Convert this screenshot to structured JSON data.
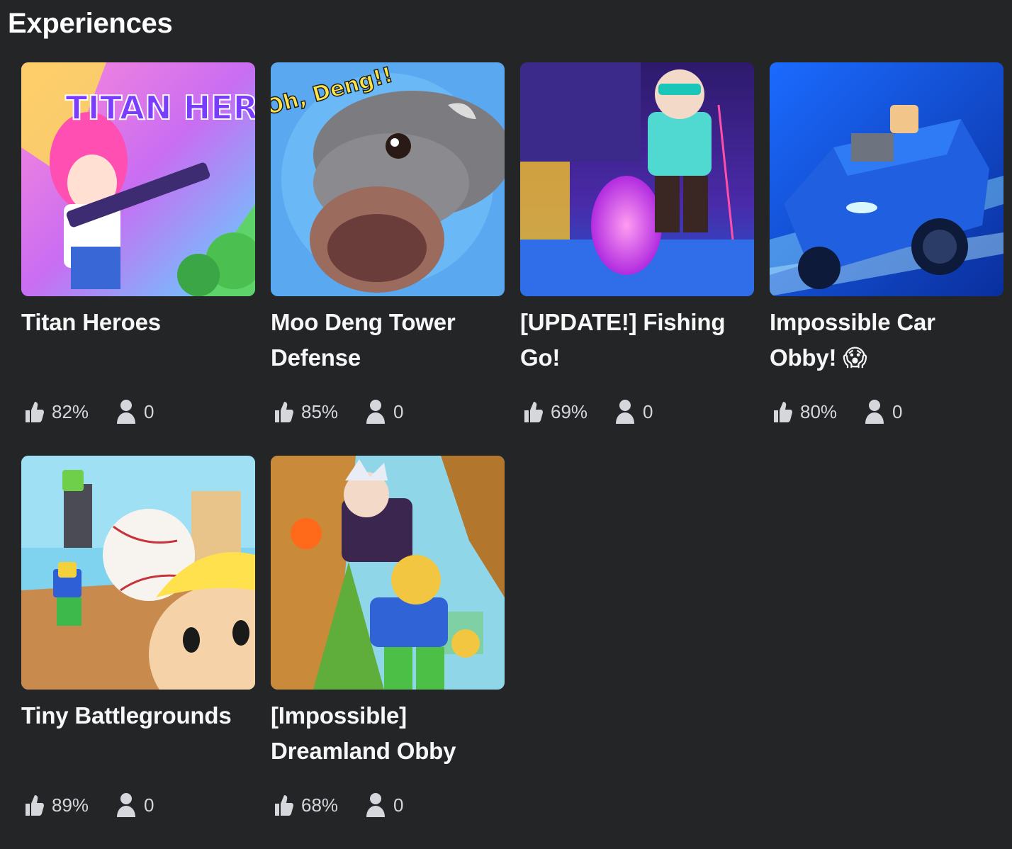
{
  "section": {
    "title": "Experiences"
  },
  "games": [
    {
      "title": "Titan Heroes",
      "rating": "82%",
      "players": "0",
      "thumb_text": "TITAN HEROES"
    },
    {
      "title": "Moo Deng Tower Defense",
      "rating": "85%",
      "players": "0",
      "thumb_text": "Oh, Deng!!"
    },
    {
      "title": "[UPDATE!] Fishing Go!",
      "rating": "69%",
      "players": "0"
    },
    {
      "title": "Impossible Car Obby! 😱",
      "rating": "80%",
      "players": "0"
    },
    {
      "title": "Tiny Battlegrounds",
      "rating": "89%",
      "players": "0"
    },
    {
      "title": "[Impossible] Dreamland Obby",
      "rating": "68%",
      "players": "0"
    }
  ],
  "icons": {
    "rating": "thumbs-up-icon",
    "players": "player-count-icon"
  },
  "colors": {
    "background": "#232527",
    "text": "#ffffff",
    "stat_text": "#d5d7dd"
  }
}
